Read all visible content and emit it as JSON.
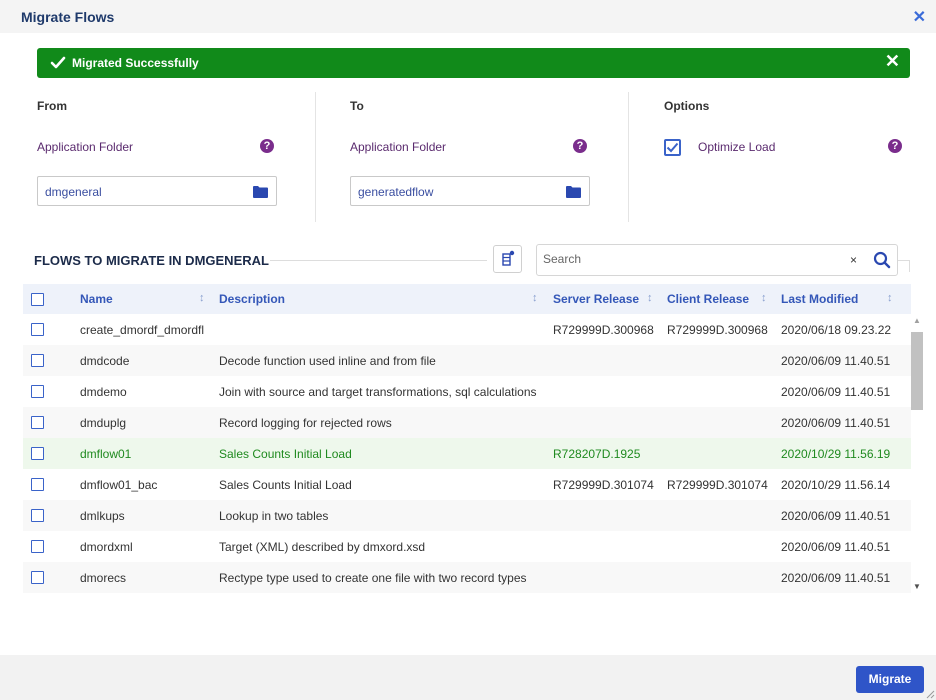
{
  "dialog": {
    "title": "Migrate Flows",
    "close_icon": "close-icon"
  },
  "banner": {
    "message": "Migrated Successfully",
    "color": "#118a1a"
  },
  "from": {
    "heading": "From",
    "label": "Application Folder",
    "value": "dmgeneral"
  },
  "to": {
    "heading": "To",
    "label": "Application Folder",
    "value": "generatedflow"
  },
  "options": {
    "heading": "Options",
    "optimize_label": "Optimize Load",
    "optimize_checked": true
  },
  "help_glyph": "?",
  "flows": {
    "title": "FLOWS TO MIGRATE IN DMGENERAL",
    "search_placeholder": "Search",
    "clear_glyph": "×",
    "columns": [
      "Name",
      "Description",
      "Server Release",
      "Client Release",
      "Last Modified"
    ],
    "rows": [
      {
        "name": "create_dmordf_dmordfl",
        "description": "",
        "server": "R729999D.300968",
        "client": "R729999D.300968",
        "modified": "2020/06/18 09.23.22"
      },
      {
        "name": "dmdcode",
        "description": "Decode function used inline and from file",
        "server": "",
        "client": "",
        "modified": "2020/06/09 11.40.51"
      },
      {
        "name": "dmdemo",
        "description": "Join with source and target transformations, sql calculations",
        "server": "",
        "client": "",
        "modified": "2020/06/09 11.40.51"
      },
      {
        "name": "dmduplg",
        "description": "Record logging for rejected rows",
        "server": "",
        "client": "",
        "modified": "2020/06/09 11.40.51"
      },
      {
        "name": "dmflow01",
        "description": "Sales Counts Initial Load",
        "server": "R728207D.1925",
        "client": "",
        "modified": "2020/10/29 11.56.19",
        "highlight": true
      },
      {
        "name": "dmflow01_bac",
        "description": "Sales Counts Initial Load",
        "server": "R729999D.301074",
        "client": "R729999D.301074",
        "modified": "2020/10/29 11.56.14"
      },
      {
        "name": "dmlkups",
        "description": "Lookup in two tables",
        "server": "",
        "client": "",
        "modified": "2020/06/09 11.40.51"
      },
      {
        "name": "dmordxml",
        "description": "Target (XML) described by dmxord.xsd",
        "server": "",
        "client": "",
        "modified": "2020/06/09 11.40.51"
      },
      {
        "name": "dmorecs",
        "description": "Rectype type used to create one file with two record types",
        "server": "",
        "client": "",
        "modified": "2020/06/09 11.40.51"
      }
    ]
  },
  "footer": {
    "migrate_label": "Migrate"
  },
  "colors": {
    "accent": "#2f55c8",
    "success": "#118a1a",
    "label_purple": "#5a2a6e",
    "highlight_row": "#eef8ec"
  }
}
